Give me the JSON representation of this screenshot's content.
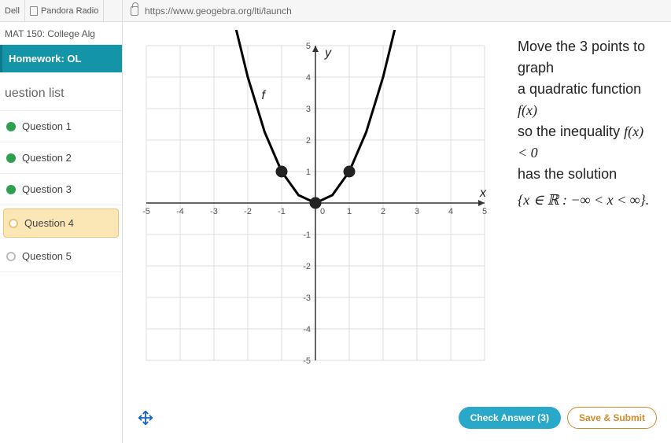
{
  "tabs": {
    "t0": "Dell",
    "t1": "Pandora Radio"
  },
  "url": "https://www.geogebra.org/lti/launch",
  "sidebar": {
    "course": "MAT 150: College Alg",
    "homework": "Homework: OL",
    "list_title": "uestion list",
    "q1": "Question 1",
    "q2": "Question 2",
    "q3": "Question 3",
    "q4": "Question 4",
    "q5": "Question 5"
  },
  "prompt": {
    "line1": "Move the 3 points to graph",
    "line2a": "a quadratic function ",
    "line2b": "f(x)",
    "line3a": "so the inequality ",
    "line3b": "f(x) < 0",
    "line4": "has the solution",
    "solution_set": "{x ∈ ℝ : −∞ < x < ∞}."
  },
  "buttons": {
    "check": "Check Answer (3)",
    "save": "Save & Submit"
  },
  "chart_data": {
    "type": "line",
    "title": "",
    "xlabel": "x",
    "ylabel": "y",
    "function_label": "f",
    "xlim": [
      -5,
      5
    ],
    "ylim": [
      -5,
      5
    ],
    "x_ticks": [
      -5,
      -4,
      -3,
      -2,
      -1,
      0,
      1,
      2,
      3,
      4,
      5
    ],
    "y_ticks": [
      -5,
      -4,
      -3,
      -2,
      -1,
      0,
      1,
      2,
      3,
      4,
      5
    ],
    "series": [
      {
        "name": "f",
        "x": [
          -2.4,
          -2,
          -1.5,
          -1,
          -0.5,
          0,
          0.5,
          1,
          1.5,
          2,
          2.4
        ],
        "y": [
          5.76,
          4,
          2.25,
          1,
          0.25,
          0,
          0.25,
          1,
          2.25,
          4,
          5.76
        ]
      }
    ],
    "control_points": [
      {
        "x": -1,
        "y": 1
      },
      {
        "x": 0,
        "y": 0
      },
      {
        "x": 1,
        "y": 1
      }
    ]
  }
}
